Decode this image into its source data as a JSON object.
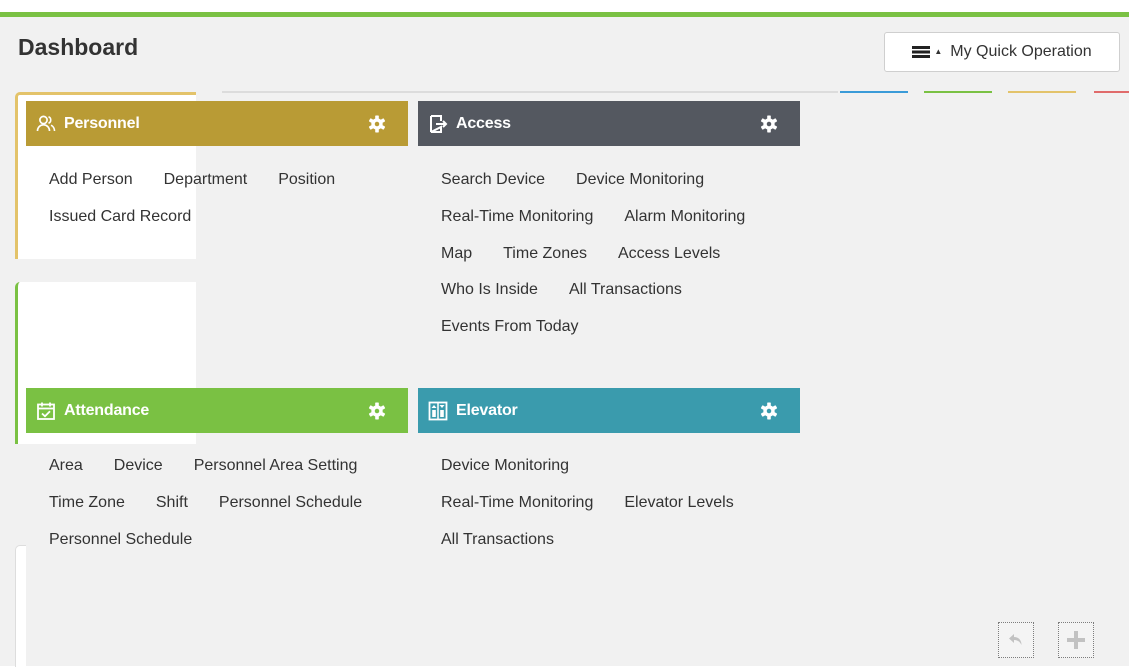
{
  "header": {
    "title": "Dashboard",
    "quick_operation_label": "My Quick Operation"
  },
  "colors": {
    "accent_top": "#7ac143",
    "personnel": "#b99b35",
    "access": "#545860",
    "attendance": "#7ac143",
    "elevator": "#3a9bad"
  },
  "panels": {
    "personnel": {
      "title": "Personnel",
      "icon": "users-icon",
      "links": [
        [
          "Add Person",
          "Department",
          "Position"
        ],
        [
          "Issued Card Record"
        ]
      ]
    },
    "access": {
      "title": "Access",
      "icon": "door-exit-icon",
      "links": [
        [
          "Search Device",
          "Device Monitoring"
        ],
        [
          "Real-Time Monitoring",
          "Alarm Monitoring"
        ],
        [
          "Map",
          "Time Zones",
          "Access Levels"
        ],
        [
          "Who Is Inside",
          "All Transactions"
        ],
        [
          "Events From Today"
        ]
      ]
    },
    "attendance": {
      "title": "Attendance",
      "icon": "calendar-check-icon",
      "links": [
        [
          "Area",
          "Device",
          "Personnel Area Setting"
        ],
        [
          "Time Zone",
          "Shift",
          "Personnel Schedule"
        ],
        [
          "Personnel Schedule"
        ]
      ]
    },
    "elevator": {
      "title": "Elevator",
      "icon": "elevator-icon",
      "links": [
        [
          "Device Monitoring"
        ],
        [
          "Real-Time Monitoring",
          "Elevator Levels"
        ],
        [
          "All Transactions"
        ]
      ]
    }
  },
  "corner_buttons": {
    "undo_icon": "undo-icon",
    "add_icon": "plus-icon"
  }
}
